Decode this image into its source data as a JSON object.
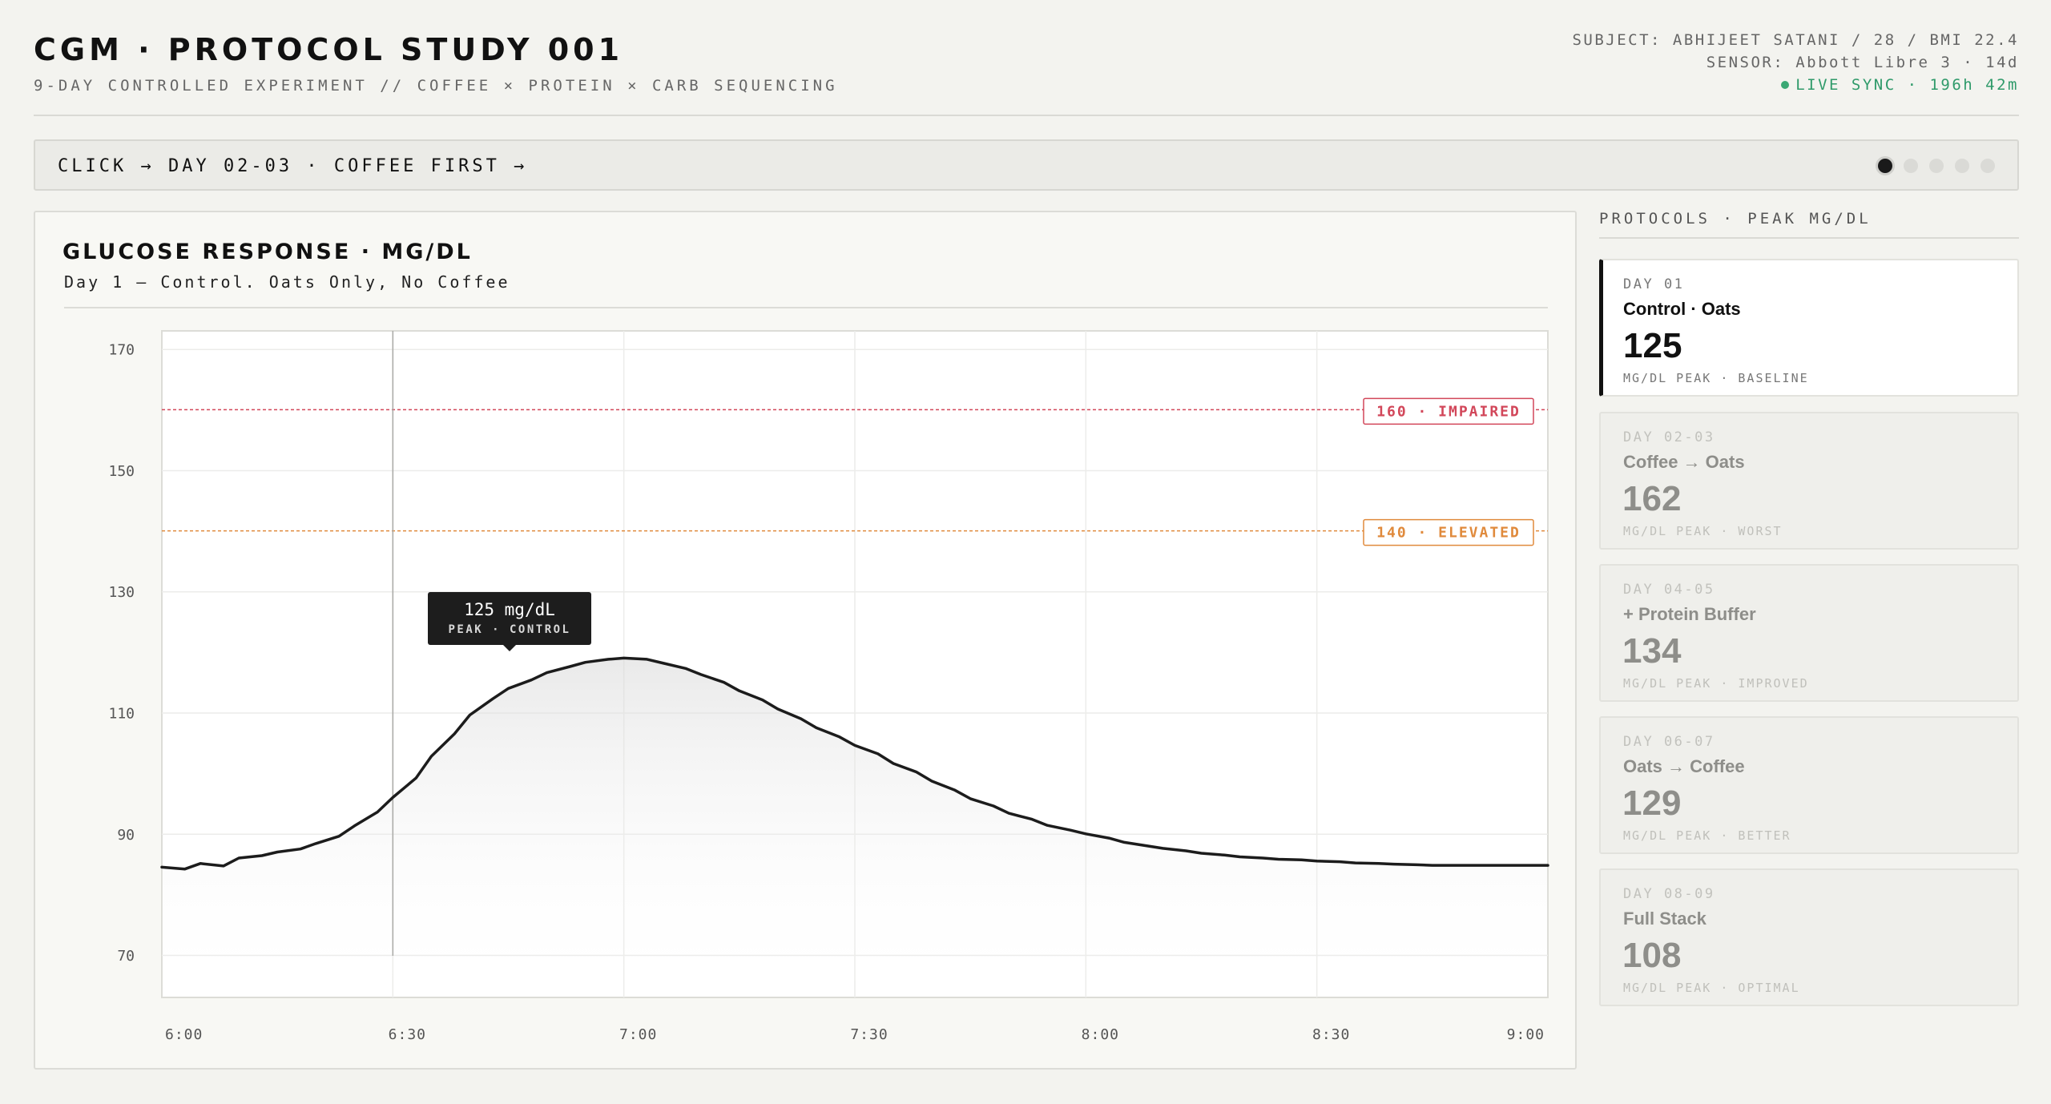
{
  "header": {
    "title": "CGM · PROTOCOL STUDY 001",
    "subtitle": "9-DAY CONTROLLED EXPERIMENT // COFFEE × PROTEIN × CARB SEQUENCING",
    "subject": "SUBJECT: ABHIJEET SATANI / 28 / BMI 22.4",
    "sensor": "SENSOR: Abbott Libre 3 · 14d",
    "live_sync": "LIVE SYNC · 196h 42m",
    "live_color": "#2f9a6a"
  },
  "prompt_bar": {
    "text": "CLICK → DAY 02-03 · COFFEE FIRST  →",
    "pages": 5,
    "active_page": 1
  },
  "chart": {
    "title": "GLUCOSE RESPONSE · MG/DL",
    "subtitle": "Day 1 — Control. Oats Only, No Coffee",
    "tooltip_value": "125 mg/dL",
    "tooltip_label": "PEAK · CONTROL"
  },
  "chart_data": {
    "type": "area",
    "title": "GLUCOSE RESPONSE · MG/DL",
    "subtitle": "Day 1 — Control. Oats Only, No Coffee",
    "xlabel": "",
    "ylabel": "",
    "x_ticks": [
      "6:00",
      "6:30",
      "7:00",
      "7:30",
      "8:00",
      "8:30",
      "9:00"
    ],
    "y_ticks": [
      170,
      150,
      130,
      110,
      90,
      70
    ],
    "ylim": [
      63,
      173
    ],
    "xlim_minutes_after_6": [
      0,
      180
    ],
    "grid": true,
    "line_color": "#1c1c1c",
    "thresholds": [
      {
        "value": 160,
        "label": "160 · IMPAIRED",
        "color": "#d2475a"
      },
      {
        "value": 140,
        "label": "140 · ELEVATED",
        "color": "#e08a3c"
      }
    ],
    "cursor_time": "6:30",
    "series": [
      {
        "x": [
          "6:00",
          "6:03",
          "6:05",
          "6:08",
          "6:10",
          "6:13",
          "6:15",
          "6:18",
          "6:20",
          "6:23",
          "6:25",
          "6:28",
          "6:30",
          "6:33",
          "6:35",
          "6:38",
          "6:40",
          "6:43",
          "6:45",
          "6:48",
          "6:50",
          "6:53",
          "6:55",
          "6:58",
          "7:00",
          "7:03",
          "7:05",
          "7:08",
          "7:10",
          "7:13",
          "7:15",
          "7:18",
          "7:20",
          "7:23",
          "7:25",
          "7:28",
          "7:30",
          "7:33",
          "7:35",
          "7:38",
          "7:40",
          "7:43",
          "7:45",
          "7:48",
          "7:50",
          "7:53",
          "7:55",
          "7:58",
          "8:00",
          "8:03",
          "8:05",
          "8:08",
          "8:10",
          "8:13",
          "8:15",
          "8:18",
          "8:20",
          "8:23",
          "8:25",
          "8:28",
          "8:30",
          "8:33",
          "8:35",
          "8:38",
          "8:40",
          "8:43",
          "8:45",
          "8:48",
          "8:50",
          "8:53",
          "8:55",
          "8:58",
          "9:00"
        ],
        "values": [
          84.5,
          84.2,
          85.1,
          84.7,
          86.0,
          86.4,
          87.0,
          87.5,
          88.4,
          89.6,
          91.3,
          93.6,
          96.0,
          99.2,
          102.8,
          106.5,
          109.6,
          112.3,
          114.0,
          115.4,
          116.6,
          117.6,
          118.3,
          118.8,
          119.0,
          118.8,
          118.2,
          117.3,
          116.3,
          115.0,
          113.6,
          112.1,
          110.6,
          109.0,
          107.5,
          106.0,
          104.6,
          103.2,
          101.6,
          100.2,
          98.7,
          97.2,
          95.8,
          94.6,
          93.4,
          92.4,
          91.4,
          90.6,
          90.0,
          89.3,
          88.6,
          88.0,
          87.6,
          87.2,
          86.8,
          86.5,
          86.2,
          86.0,
          85.8,
          85.7,
          85.5,
          85.4,
          85.2,
          85.1,
          85.0,
          84.9,
          84.8,
          84.8,
          84.8,
          84.8,
          84.8,
          84.8,
          84.8
        ]
      }
    ]
  },
  "sidebar": {
    "header": "PROTOCOLS · PEAK MG/DL",
    "cards": [
      {
        "label": "DAY 01",
        "name": "Control · Oats",
        "value": "125",
        "foot": "MG/DL PEAK · BASELINE"
      },
      {
        "label": "DAY 02-03",
        "name": "Coffee → Oats",
        "value": "162",
        "foot": "MG/DL PEAK · WORST"
      },
      {
        "label": "DAY 04-05",
        "name": "+ Protein Buffer",
        "value": "134",
        "foot": "MG/DL PEAK · IMPROVED"
      },
      {
        "label": "DAY 06-07",
        "name": "Oats → Coffee",
        "value": "129",
        "foot": "MG/DL PEAK · BETTER"
      },
      {
        "label": "DAY 08-09",
        "name": "Full Stack",
        "value": "108",
        "foot": "MG/DL PEAK · OPTIMAL"
      }
    ]
  }
}
